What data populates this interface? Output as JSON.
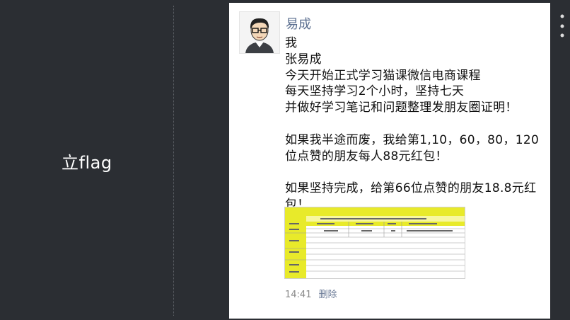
{
  "slide": {
    "title": "立flag"
  },
  "post": {
    "author": "易成",
    "lines": [
      "我",
      "张易成",
      "今天开始正式学习猫课微信电商课程",
      "每天坚持学习2个小时，坚持七天",
      "并做好学习笔记和问题整理发朋友圈证明！",
      "",
      "如果我半途而废，我给第1,10，60，80，120",
      "位点赞的朋友每人88元红包！",
      "",
      "如果坚持完成，给第66位点赞的朋友18.8元红",
      "包！"
    ],
    "time": "14:41",
    "delete_label": "删除"
  },
  "colors": {
    "background": "#2b2e33",
    "card": "#ffffff",
    "author": "#5a6e8f",
    "thumb_accent": "#e8ea2a"
  },
  "icons": {
    "menu": "more-vert-icon",
    "avatar": "avatar-cartoon-icon"
  }
}
